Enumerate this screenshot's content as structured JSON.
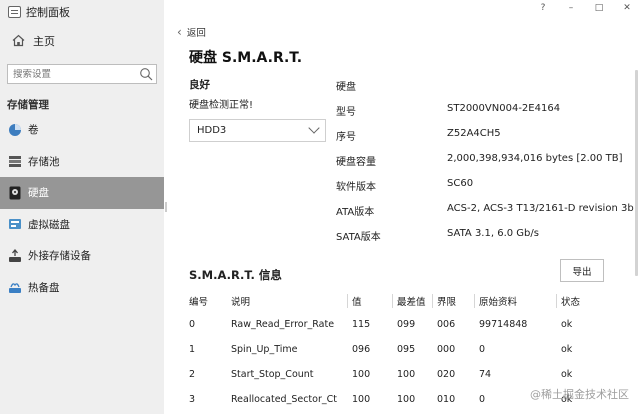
{
  "app": {
    "title": "控制面板"
  },
  "window": {
    "help": "?",
    "minimize": "–",
    "maximize": "□",
    "close": "✕"
  },
  "sidebar": {
    "home": "主页",
    "search_placeholder": "搜索设置",
    "section": "存储管理",
    "items": [
      {
        "label": "卷",
        "icon": "volume-icon"
      },
      {
        "label": "存储池",
        "icon": "storage-pool-icon"
      },
      {
        "label": "硬盘",
        "icon": "hard-disk-icon",
        "active": true
      },
      {
        "label": "虚拟磁盘",
        "icon": "virtual-disk-icon"
      },
      {
        "label": "外接存储设备",
        "icon": "external-storage-icon"
      },
      {
        "label": "热备盘",
        "icon": "hot-spare-icon"
      }
    ]
  },
  "main": {
    "back": "返回",
    "title": "硬盘 S.M.A.R.T.",
    "health_status": "良好",
    "health_message": "硬盘检测正常!",
    "selected_disk": "HDD3",
    "info_heading": "硬盘",
    "info": [
      {
        "label": "型号",
        "value": "ST2000VN004-2E4164"
      },
      {
        "label": "序号",
        "value": "Z52A4CH5"
      },
      {
        "label": "硬盘容量",
        "value": "2,000,398,934,016 bytes [2.00 TB]"
      },
      {
        "label": "软件版本",
        "value": "SC60"
      },
      {
        "label": "ATA版本",
        "value": "ACS-2, ACS-3 T13/2161-D revision 3b"
      },
      {
        "label": "SATA版本",
        "value": "SATA 3.1, 6.0 Gb/s"
      }
    ],
    "smart_title": "S.M.A.R.T. 信息",
    "export": "导出",
    "columns": [
      "编号",
      "说明",
      "值",
      "最差值",
      "界限",
      "原始资料",
      "状态"
    ],
    "rows": [
      [
        "0",
        "Raw_Read_Error_Rate",
        "115",
        "099",
        "006",
        "99714848",
        "ok"
      ],
      [
        "1",
        "Spin_Up_Time",
        "096",
        "095",
        "000",
        "0",
        "ok"
      ],
      [
        "2",
        "Start_Stop_Count",
        "100",
        "100",
        "020",
        "74",
        "ok"
      ],
      [
        "3",
        "Reallocated_Sector_Ct",
        "100",
        "100",
        "010",
        "0",
        "ok"
      ]
    ]
  },
  "watermark": "@稀土掘金技术社区"
}
